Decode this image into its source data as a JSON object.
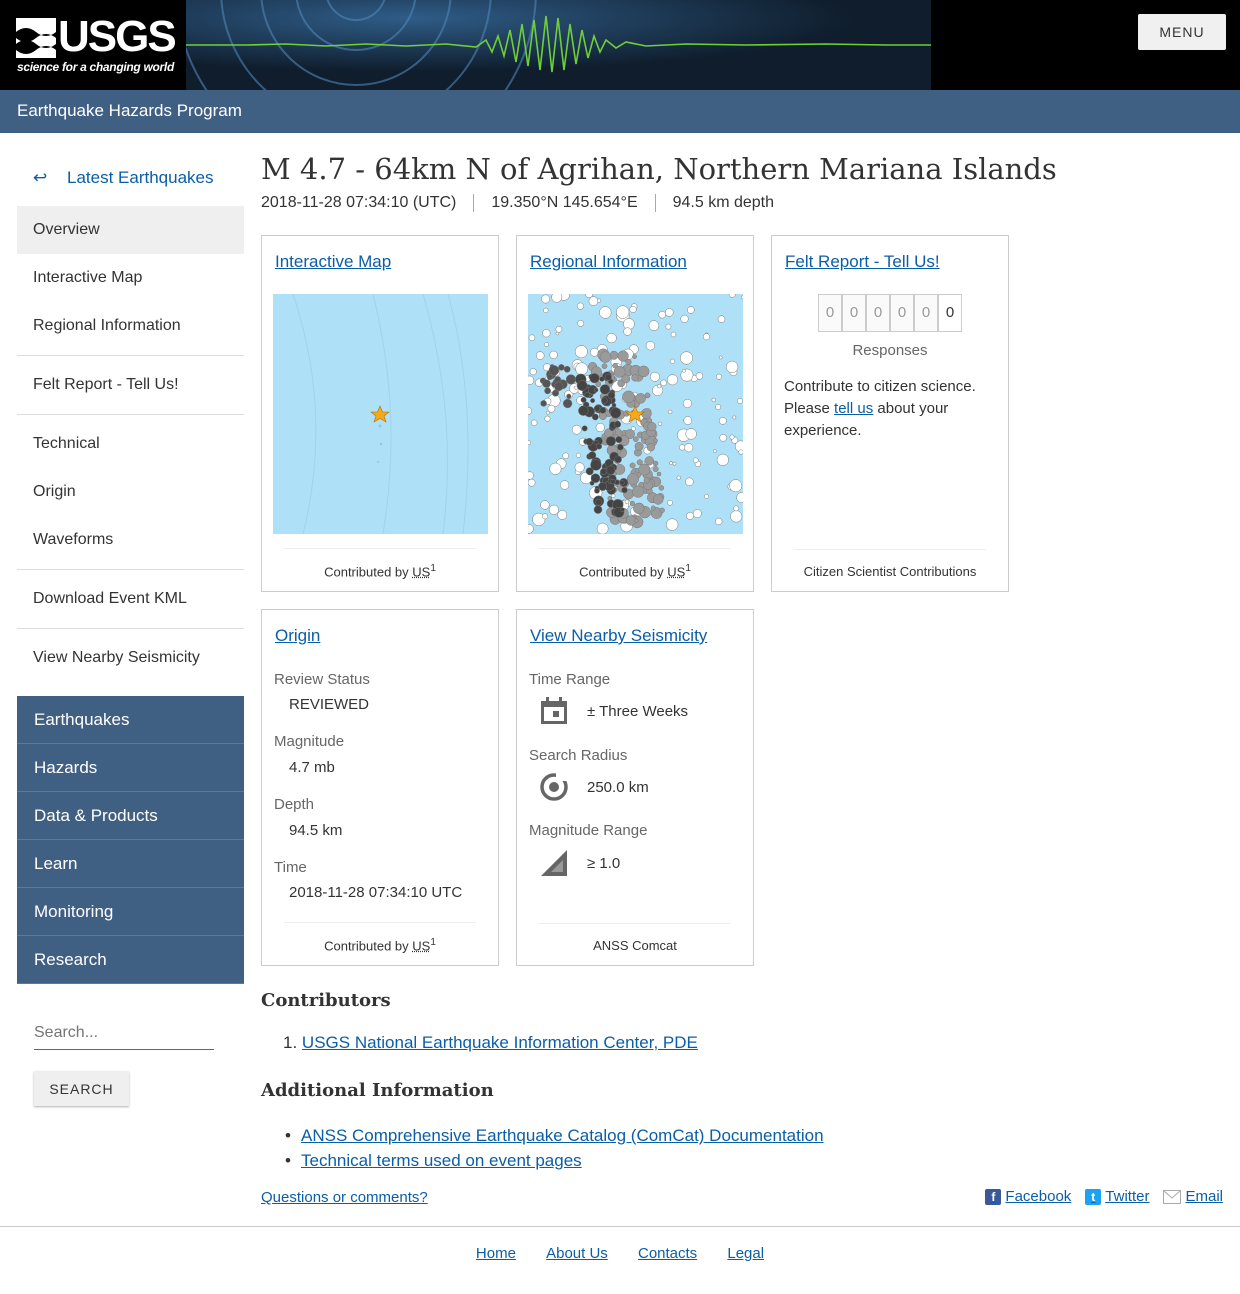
{
  "header": {
    "logo_text": "USGS",
    "logo_tagline": "science for a changing world",
    "menu_label": "MENU",
    "program": "Earthquake Hazards Program"
  },
  "sidebar": {
    "latest": "Latest Earthquakes",
    "items": [
      {
        "label": "Overview"
      },
      {
        "label": "Interactive Map"
      },
      {
        "label": "Regional Information"
      },
      {
        "label": "Felt Report - Tell Us!"
      },
      {
        "label": "Technical"
      },
      {
        "label": "Origin"
      },
      {
        "label": "Waveforms"
      },
      {
        "label": "Download Event KML"
      },
      {
        "label": "View Nearby Seismicity"
      }
    ],
    "sections": [
      {
        "label": "Earthquakes"
      },
      {
        "label": "Hazards"
      },
      {
        "label": "Data & Products"
      },
      {
        "label": "Learn"
      },
      {
        "label": "Monitoring"
      },
      {
        "label": "Research"
      }
    ],
    "search_placeholder": "Search...",
    "search_button": "SEARCH"
  },
  "event": {
    "title": "M 4.7 - 64km N of Agrihan, Northern Mariana Islands",
    "time": "2018-11-28 07:34:10 (UTC)",
    "location": "19.350°N 145.654°E",
    "depth": "94.5 km depth"
  },
  "cards": {
    "map": {
      "title": "Interactive Map",
      "contributed": "Contributed by",
      "source": "US",
      "ref": "1"
    },
    "regional": {
      "title": "Regional Information",
      "contributed": "Contributed by",
      "source": "US",
      "ref": "1"
    },
    "felt": {
      "title": "Felt Report - Tell Us!",
      "digits": [
        "0",
        "0",
        "0",
        "0",
        "0",
        "0"
      ],
      "responses_label": "Responses",
      "text_before": "Contribute to citizen science. Please ",
      "link": "tell us",
      "text_after": " about your experience.",
      "footer": "Citizen Scientist Contributions"
    },
    "origin": {
      "title": "Origin",
      "review_status_label": "Review Status",
      "review_status": "REVIEWED",
      "magnitude_label": "Magnitude",
      "magnitude": "4.7 mb",
      "depth_label": "Depth",
      "depth": "94.5 km",
      "time_label": "Time",
      "time": "2018-11-28 07:34:10 UTC",
      "contributed": "Contributed by",
      "source": "US",
      "ref": "1"
    },
    "nearby": {
      "title": "View Nearby Seismicity",
      "time_range_label": "Time Range",
      "time_range": "± Three Weeks",
      "radius_label": "Search Radius",
      "radius": "250.0 km",
      "mag_range_label": "Magnitude Range",
      "mag_range": "≥ 1.0",
      "footer": "ANSS Comcat"
    }
  },
  "contributors": {
    "heading": "Contributors",
    "items": [
      "USGS National Earthquake Information Center, PDE"
    ]
  },
  "additional": {
    "heading": "Additional Information",
    "items": [
      "ANSS Comprehensive Earthquake Catalog (ComCat) Documentation",
      "Technical terms used on event pages"
    ]
  },
  "feedback": "Questions or comments?",
  "social": {
    "facebook": "Facebook",
    "twitter": "Twitter",
    "email": "Email"
  },
  "footer_links": [
    "Home",
    "About Us",
    "Contacts",
    "Legal"
  ],
  "colors": {
    "brand_blue": "#3f5f83",
    "link": "#0a5ea8",
    "ocean": "#aee0f7",
    "star": "#f7a91b"
  }
}
